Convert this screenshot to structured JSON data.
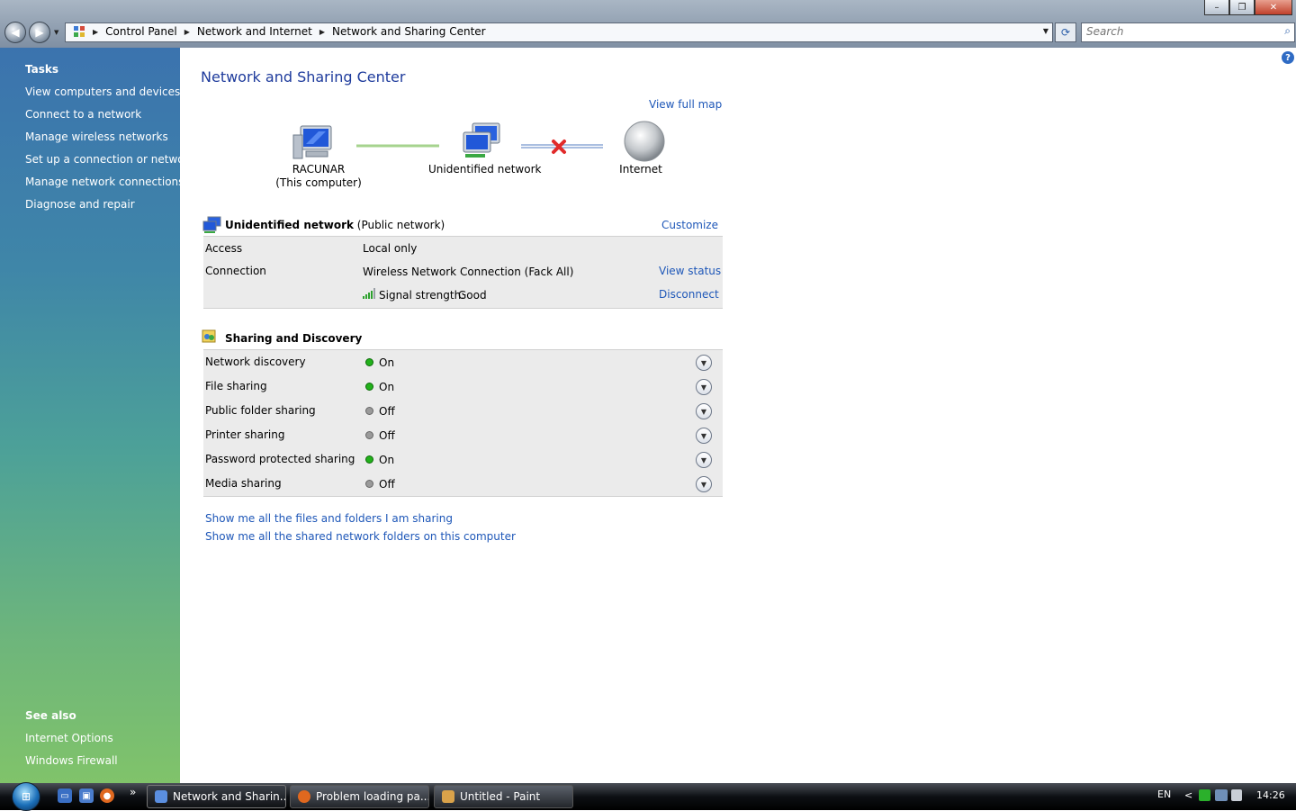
{
  "window": {
    "caption_buttons": {
      "minimize": "–",
      "maximize": "❐",
      "close": "✕"
    },
    "nav": {
      "back": "◀",
      "forward": "▶"
    },
    "breadcrumbs": [
      "Control Panel",
      "Network and Internet",
      "Network and Sharing Center"
    ],
    "search_placeholder": "Search"
  },
  "sidebar": {
    "tasks_heading": "Tasks",
    "tasks": [
      "View computers and devices",
      "Connect to a network",
      "Manage wireless networks",
      "Set up a connection or network",
      "Manage network connections",
      "Diagnose and repair"
    ],
    "see_also_heading": "See also",
    "see_also": [
      "Internet Options",
      "Windows Firewall"
    ]
  },
  "main": {
    "title": "Network and Sharing Center",
    "view_full_map": "View full map",
    "map": {
      "computer_name": "RACUNAR",
      "computer_sub": "(This computer)",
      "network": "Unidentified network",
      "internet": "Internet"
    },
    "network_section": {
      "name": "Unidentified network",
      "type": "(Public network)",
      "customize": "Customize",
      "access_label": "Access",
      "access_value": "Local only",
      "connection_label": "Connection",
      "connection_value": "Wireless Network Connection (Fack All)",
      "view_status": "View status",
      "signal_label": "Signal strength:",
      "signal_value": "Good",
      "disconnect": "Disconnect"
    },
    "sharing_section": {
      "title": "Sharing and Discovery",
      "rows": [
        {
          "label": "Network discovery",
          "state": "On"
        },
        {
          "label": "File sharing",
          "state": "On"
        },
        {
          "label": "Public folder sharing",
          "state": "Off"
        },
        {
          "label": "Printer sharing",
          "state": "Off"
        },
        {
          "label": "Password protected sharing",
          "state": "On"
        },
        {
          "label": "Media sharing",
          "state": "Off"
        }
      ]
    },
    "links": [
      "Show me all the files and folders I am sharing",
      "Show me all the shared network folders on this computer"
    ]
  },
  "taskbar": {
    "windows": [
      {
        "label": "Network and Sharin...",
        "active": true
      },
      {
        "label": "Problem loading pa...",
        "active": false
      },
      {
        "label": "Untitled - Paint",
        "active": false
      }
    ],
    "quicklaunch_more": "»",
    "language": "EN",
    "tray_arrow": "<",
    "clock": "14:26"
  },
  "colors": {
    "link": "#1e57b8",
    "title": "#1e3b9c",
    "status_on": "#22b11b",
    "status_off": "#9a9a9a"
  }
}
